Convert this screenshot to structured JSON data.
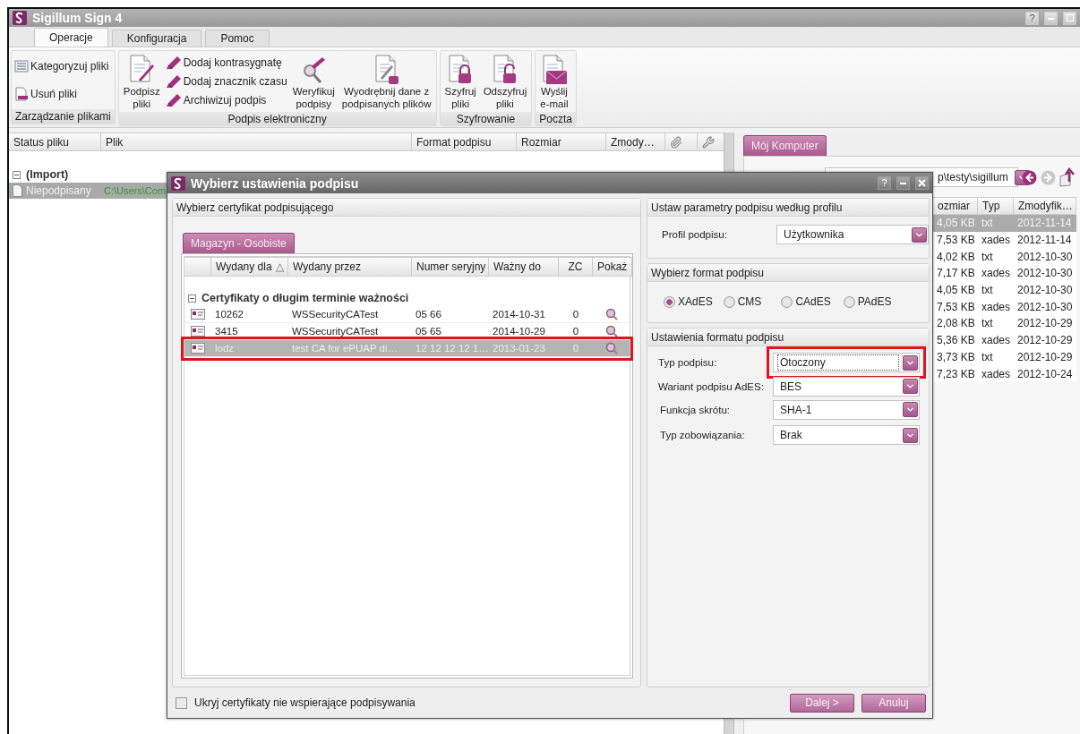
{
  "app": {
    "title": "Sigillum Sign 4",
    "help": "?"
  },
  "tabs": [
    {
      "label": "Operacje",
      "selected": true
    },
    {
      "label": "Konfiguracja",
      "selected": false
    },
    {
      "label": "Pomoc",
      "selected": false
    }
  ],
  "ribbon": [
    {
      "label": "Zarządzanie plikami",
      "items": [
        {
          "kind": "stack",
          "items": [
            {
              "label": "Kategoryzuj pliki"
            },
            {
              "label": "Usuń pliki"
            }
          ]
        }
      ]
    },
    {
      "label": "Podpis elektroniczny",
      "items": [
        {
          "kind": "large",
          "label": "Podpisz\npliki"
        },
        {
          "kind": "stack",
          "items": [
            {
              "label": "Dodaj kontrasygnatę"
            },
            {
              "label": "Dodaj znacznik czasu"
            },
            {
              "label": "Archiwizuj podpis"
            }
          ]
        },
        {
          "kind": "large",
          "label": "Weryfikuj\npodpisy"
        },
        {
          "kind": "large",
          "label": "Wyodrębnij dane z\npodpisanych plików"
        }
      ]
    },
    {
      "label": "Szyfrowanie",
      "items": [
        {
          "kind": "large",
          "label": "Szyfruj\npliki"
        },
        {
          "kind": "large",
          "label": "Odszyfruj\npliki"
        }
      ]
    },
    {
      "label": "Poczta",
      "items": [
        {
          "kind": "large",
          "label": "Wyślij\ne-mail"
        }
      ]
    }
  ],
  "file_table": {
    "columns": [
      "Status pliku",
      "Plik",
      "Format podpisu",
      "Rozmiar",
      "Zmody…"
    ],
    "groups": [
      {
        "label": "(Import)",
        "expanded": true,
        "rows": [
          {
            "status": "Niepodpisany",
            "file": "C:\\Users\\Com",
            "selected": true
          }
        ]
      }
    ]
  },
  "explorer": {
    "tab": {
      "label": "Mój Komputer",
      "selected": true
    },
    "path": "p\\testy\\sigillum",
    "columns": [
      "ozmiar",
      "Typ",
      "Zmodyfik…"
    ],
    "rows": [
      {
        "size": "4,05 KB",
        "type": "txt",
        "modified": "2012-11-14",
        "selected": true
      },
      {
        "size": "7,53 KB",
        "type": "xades",
        "modified": "2012-11-14",
        "selected": false
      },
      {
        "size": "4,02 KB",
        "type": "txt",
        "modified": "2012-10-30",
        "selected": false
      },
      {
        "size": "7,17 KB",
        "type": "xades",
        "modified": "2012-10-30",
        "selected": false
      },
      {
        "size": "4,05 KB",
        "type": "txt",
        "modified": "2012-10-30",
        "selected": false
      },
      {
        "size": "7,53 KB",
        "type": "xades",
        "modified": "2012-10-30",
        "selected": false
      },
      {
        "size": "2,08 KB",
        "type": "txt",
        "modified": "2012-10-29",
        "selected": false
      },
      {
        "size": "5,36 KB",
        "type": "xades",
        "modified": "2012-10-29",
        "selected": false
      },
      {
        "size": "3,73 KB",
        "type": "txt",
        "modified": "2012-10-29",
        "selected": false
      },
      {
        "size": "7,23 KB",
        "type": "xades",
        "modified": "2012-10-24",
        "selected": false
      }
    ]
  },
  "dialog": {
    "title": "Wybierz ustawienia podpisu",
    "help": "?",
    "certificates": {
      "heading": "Wybierz certyfikat podpisującego",
      "tab": {
        "label": "Magazyn - Osobiste",
        "selected": true
      },
      "columns": [
        "Wydany dla",
        "Wydany przez",
        "Numer seryjny",
        "Ważny do",
        "ZC",
        "Pokaż"
      ],
      "sort_mark": "△",
      "groups": [
        {
          "label": "Certyfikaty o długim terminie ważności",
          "expanded": true,
          "rows": [
            {
              "issued_to": "10262",
              "issued_by": "WSSecurityCATest",
              "serial": "05 66",
              "valid_to": "2014-10-31",
              "zc": "0",
              "selected": false,
              "highlighted": false
            },
            {
              "issued_to": "3415",
              "issued_by": "WSSecurityCATest",
              "serial": "05 65",
              "valid_to": "2014-10-29",
              "zc": "0",
              "selected": false,
              "highlighted": false
            },
            {
              "issued_to": "lodz",
              "issued_by": "test CA for ePUAP di…",
              "serial": "12 12 12 12 1…",
              "valid_to": "2013-01-23",
              "zc": "0",
              "selected": true,
              "highlighted": true
            }
          ]
        }
      ]
    },
    "profile": {
      "heading": "Ustaw parametry podpisu według profilu",
      "label": "Profil podpisu:",
      "value": "Użytkownika"
    },
    "format": {
      "heading": "Wybierz format podpisu",
      "options": [
        {
          "label": "XAdES",
          "selected": true
        },
        {
          "label": "CMS",
          "selected": false
        },
        {
          "label": "CAdES",
          "selected": false
        },
        {
          "label": "PAdES",
          "selected": false
        }
      ]
    },
    "settings": {
      "heading": "Ustawienia formatu podpisu",
      "fields": [
        {
          "label": "Typ podpisu:",
          "value": "Otoczony",
          "focused": true,
          "highlighted": true
        },
        {
          "label": "Wariant podpisu AdES:",
          "value": "BES",
          "focused": false,
          "highlighted": false
        },
        {
          "label": "Funkcja skrótu:",
          "value": "SHA-1",
          "focused": false,
          "highlighted": false
        },
        {
          "label": "Typ zobowiązania:",
          "value": "Brak",
          "focused": false,
          "highlighted": false
        }
      ]
    },
    "hide_unsupported": {
      "label": "Ukryj certyfikaty nie wspierające podpisywania",
      "checked": false
    },
    "buttons": [
      "Dalej >",
      "Anuluj"
    ]
  }
}
